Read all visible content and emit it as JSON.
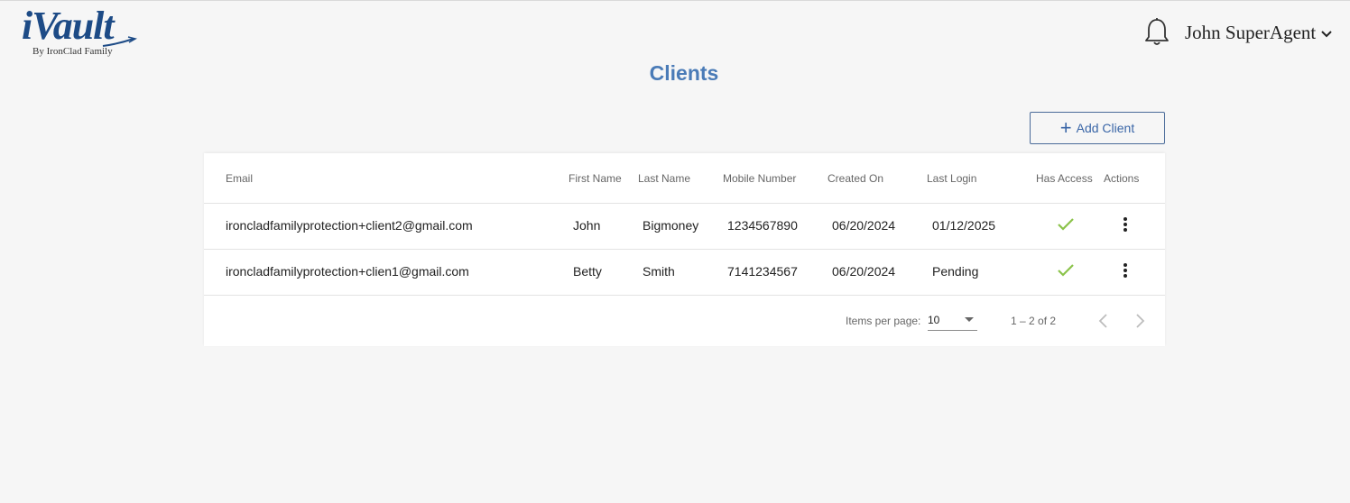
{
  "header": {
    "logo_main": "iVault",
    "logo_sub": "By IronClad Family",
    "user_name": "John SuperAgent"
  },
  "page": {
    "title": "Clients",
    "add_button_label": "Add Client"
  },
  "table": {
    "columns": [
      "Email",
      "First Name",
      "Last Name",
      "Mobile Number",
      "Created On",
      "Last Login",
      "Has Access",
      "Actions"
    ],
    "rows": [
      {
        "email": "ironcladfamilyprotection+client2@gmail.com",
        "first_name": "John",
        "last_name": "Bigmoney",
        "mobile": "1234567890",
        "created_on": "06/20/2024",
        "last_login": "01/12/2025",
        "has_access": true
      },
      {
        "email": "ironcladfamilyprotection+clien1@gmail.com",
        "first_name": "Betty",
        "last_name": "Smith",
        "mobile": "7141234567",
        "created_on": "06/20/2024",
        "last_login": "Pending",
        "has_access": true
      }
    ]
  },
  "paginator": {
    "items_per_page_label": "Items per page:",
    "page_size": "10",
    "range_label": "1 – 2 of 2"
  },
  "colors": {
    "brand_blue": "#1d4b86",
    "title_blue": "#4a7bb7",
    "check_green": "#8bc34a"
  },
  "icons": [
    "bell-icon",
    "chevron-down-icon",
    "plus-icon",
    "check-icon",
    "more-vert-icon",
    "chevron-left-icon",
    "chevron-right-icon"
  ]
}
